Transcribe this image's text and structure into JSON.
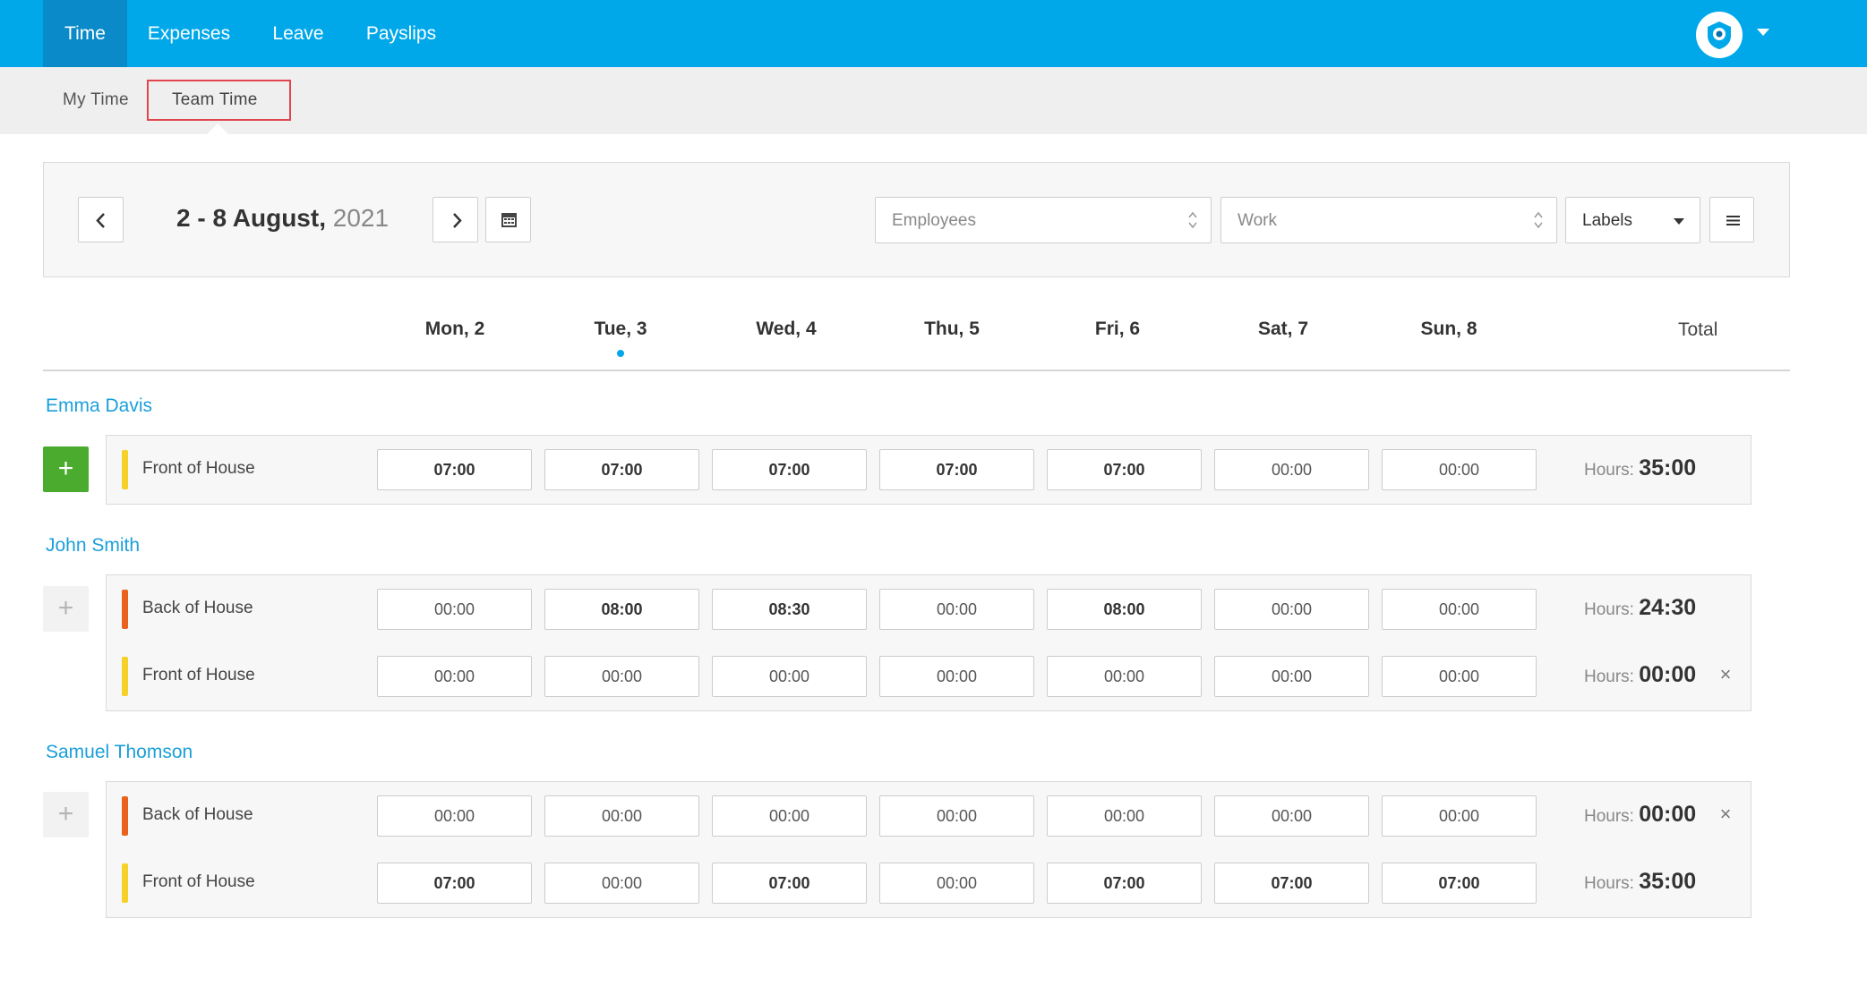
{
  "nav": {
    "tabs": [
      {
        "label": "Time",
        "active": true
      },
      {
        "label": "Expenses"
      },
      {
        "label": "Leave"
      },
      {
        "label": "Payslips"
      }
    ]
  },
  "subnav": {
    "items": [
      {
        "label": "My Time"
      },
      {
        "label": "Team Time",
        "active": true
      }
    ]
  },
  "filters": {
    "date_range": "2 - 8 August,",
    "year": "2021",
    "employees_placeholder": "Employees",
    "work_placeholder": "Work",
    "labels": "Labels"
  },
  "days": [
    "Mon, 2",
    "Tue, 3",
    "Wed, 4",
    "Thu, 5",
    "Fri, 6",
    "Sat, 7",
    "Sun, 8"
  ],
  "total_label": "Total",
  "hours_label": "Hours:",
  "colors": {
    "front_of_house": "#f5d12a",
    "back_of_house": "#e8621d",
    "accent": "#00a8ea",
    "add_green": "#4aab2f"
  },
  "employees": [
    {
      "name": "Emma Davis",
      "rows": [
        {
          "work": "Front of House",
          "cells": [
            "07:00",
            "07:00",
            "07:00",
            "07:00",
            "07:00",
            "00:00",
            "00:00"
          ],
          "total": "35:00"
        }
      ]
    },
    {
      "name": "John Smith",
      "rows": [
        {
          "work": "Back of House",
          "cells": [
            "00:00",
            "08:00",
            "08:30",
            "00:00",
            "08:00",
            "00:00",
            "00:00"
          ],
          "total": "24:30"
        },
        {
          "work": "Front of House",
          "cells": [
            "00:00",
            "00:00",
            "00:00",
            "00:00",
            "00:00",
            "00:00",
            "00:00"
          ],
          "total": "00:00"
        }
      ]
    },
    {
      "name": "Samuel Thomson",
      "rows": [
        {
          "work": "Back of House",
          "cells": [
            "00:00",
            "00:00",
            "00:00",
            "00:00",
            "00:00",
            "00:00",
            "00:00"
          ],
          "total": "00:00"
        },
        {
          "work": "Front of House",
          "cells": [
            "07:00",
            "00:00",
            "07:00",
            "00:00",
            "07:00",
            "07:00",
            "07:00"
          ],
          "total": "35:00"
        }
      ]
    }
  ]
}
